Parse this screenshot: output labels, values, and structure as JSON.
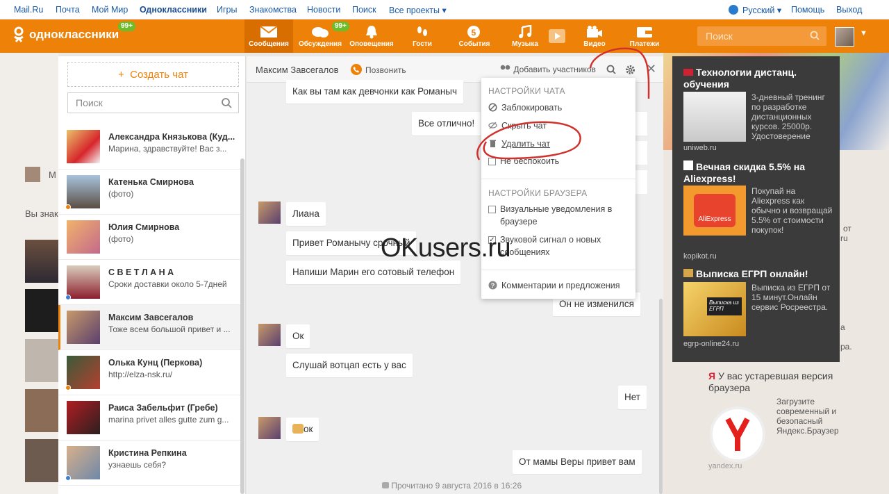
{
  "topbar": {
    "links": [
      "Mail.Ru",
      "Почта",
      "Мой Мир",
      "Одноклассники",
      "Игры",
      "Знакомства",
      "Новости",
      "Поиск",
      "Все проекты"
    ],
    "language": "Русский",
    "help": "Помощь",
    "logout": "Выход"
  },
  "header": {
    "logo": "одноклассники",
    "logo_badge": "99+",
    "nav": [
      {
        "label": "Сообщения",
        "icon": "envelope-icon"
      },
      {
        "label": "Обсуждения",
        "icon": "chat-bubbles-icon",
        "badge": "99+"
      },
      {
        "label": "Оповещения",
        "icon": "bell-icon"
      },
      {
        "label": "Гости",
        "icon": "footprints-icon"
      },
      {
        "label": "События",
        "icon": "events-icon"
      },
      {
        "label": "Музыка",
        "icon": "music-note-icon"
      },
      {
        "label": "Видео",
        "icon": "video-camera-icon"
      },
      {
        "label": "Платежи",
        "icon": "wallet-icon"
      }
    ],
    "search_placeholder": "Поиск"
  },
  "sidebar": {
    "create_chat": "Создать чат",
    "search_placeholder": "Поиск",
    "chats": [
      {
        "name": "Александра Князькова (Куд...",
        "preview": "Марина, здравствуйте! Вас з..."
      },
      {
        "name": "Катенька Смирнова",
        "preview": "(фото)"
      },
      {
        "name": "Юлия Смирнова",
        "preview": "(фото)"
      },
      {
        "name": "С В Е Т Л А Н А",
        "preview": "Сроки доставки около 5-7дней"
      },
      {
        "name": "Максим Завсегалов",
        "preview": "Тоже всем большой привет и ..."
      },
      {
        "name": "Олька Кунц (Перкова)",
        "preview": "http://elza-nsk.ru/"
      },
      {
        "name": "Раиса Забельфит (Гребе)",
        "preview": "marina privet alles gutte zum g..."
      },
      {
        "name": "Кристина Репкина",
        "preview": "узнаешь себя?"
      }
    ]
  },
  "chat": {
    "contact": "Максим Завсегалов",
    "call": "Позвонить",
    "add_participants": "Добавить участников",
    "messages": [
      {
        "text": "Как вы там как девчонки как Романыч",
        "side": "in"
      },
      {
        "text": "Все отлично!",
        "side": "out"
      },
      {
        "text": "Лиана",
        "side": "in"
      },
      {
        "text": "Привет Романычу срочный",
        "side": "in"
      },
      {
        "text": "Напиши Марин его сотовый телефон",
        "side": "in"
      },
      {
        "text": "Он не изменился",
        "side": "out"
      },
      {
        "text": "Ок",
        "side": "in"
      },
      {
        "text": "Слушай вотцап есть у вас",
        "side": "in"
      },
      {
        "text": "Нет",
        "side": "out"
      },
      {
        "text": "ок",
        "side": "in"
      },
      {
        "text": "От мамы Веры привет вам",
        "side": "out"
      }
    ],
    "read_status": "Прочитано 9 августа 2016 в 16:26"
  },
  "menu": {
    "chat_settings_title": "Настройки чата",
    "block": "Заблокировать",
    "hide": "Скрыть чат",
    "delete": "Удалить чат",
    "mute": "Не беспокоить",
    "browser_settings_title": "Настройки браузера",
    "visual_notifications": "Визуальные уведомления в браузере",
    "visual_notifications_checked": false,
    "sound_signal": "Звуковой сигнал о новых сообщениях",
    "sound_signal_checked": true,
    "feedback": "Комментарии и предложения"
  },
  "ads": [
    {
      "title": "Технологии дистанц. обучения",
      "desc": "3-дневный тренинг по разработке дистанционных курсов. 25000р. Удостоверение",
      "source": "uniweb.ru"
    },
    {
      "title": "Вечная скидка 5.5% на Aliexpress!",
      "desc": "Покупай на Aliexpress как обычно и возвращай 5.5% от стоимости покупок!",
      "source": "kopikot.ru",
      "img_text": "AliExpress"
    },
    {
      "title": "Выписка ЕГРП онлайн!",
      "desc": "Выписка из ЕГРП от 15 минут.Онлайн сервис Росреестра.",
      "source": "egrp-online24.ru",
      "img_text": "Выписка из ЕГРП"
    }
  ],
  "yandex_ad": {
    "title": "У вас устаревшая версия браузера",
    "desc": "Загрузите современный и безопасный Яндекс.Браузер",
    "source": "yandex.ru"
  },
  "background": {
    "left_name_frag": "М",
    "left_text_frag": "Вы знак",
    "right_frags": [
      "от",
      "ru",
      "а",
      "ра."
    ]
  },
  "watermark": "OKusers.ru",
  "colors": {
    "brand": "#ee8208",
    "badge": "#6dbd2a",
    "annotation": "#d0312d"
  }
}
